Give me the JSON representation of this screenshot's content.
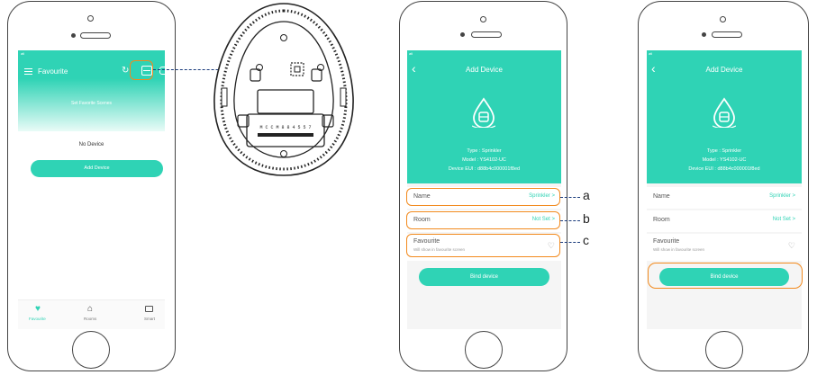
{
  "phone1": {
    "signal": "atl",
    "header_title": "Favourite",
    "subtitle": "Set Favorite Scenes",
    "empty_text": "No Device",
    "add_button": "Add Device",
    "tabs": [
      {
        "label": "Favourite",
        "icon": "heart-icon"
      },
      {
        "label": "Rooms",
        "icon": "home-icon"
      },
      {
        "label": "Smart",
        "icon": "monitor-icon"
      }
    ]
  },
  "device": {
    "barcode_text": "M C C M 8 8 4 5 5 7"
  },
  "add_device_screen": {
    "signal": "atl",
    "title": "Add Device",
    "type_line": "Type : Sprinkler",
    "model_line": "Model : YS4102-UC",
    "eui_line": "Device EUI : d88b4c000001f8ed",
    "name_label": "Name",
    "name_value": "Sprinkler",
    "room_label": "Room",
    "room_value": "Not Set",
    "favourite_label": "Favourite",
    "favourite_sub": "Will show in favourite screen",
    "bind_button": "Bind device",
    "chevron": ">"
  },
  "callouts": {
    "a": "a",
    "b": "b",
    "c": "c"
  },
  "colors": {
    "accent": "#2fd3b5",
    "highlight": "#f28a1e",
    "leader": "#1a3b7c"
  }
}
